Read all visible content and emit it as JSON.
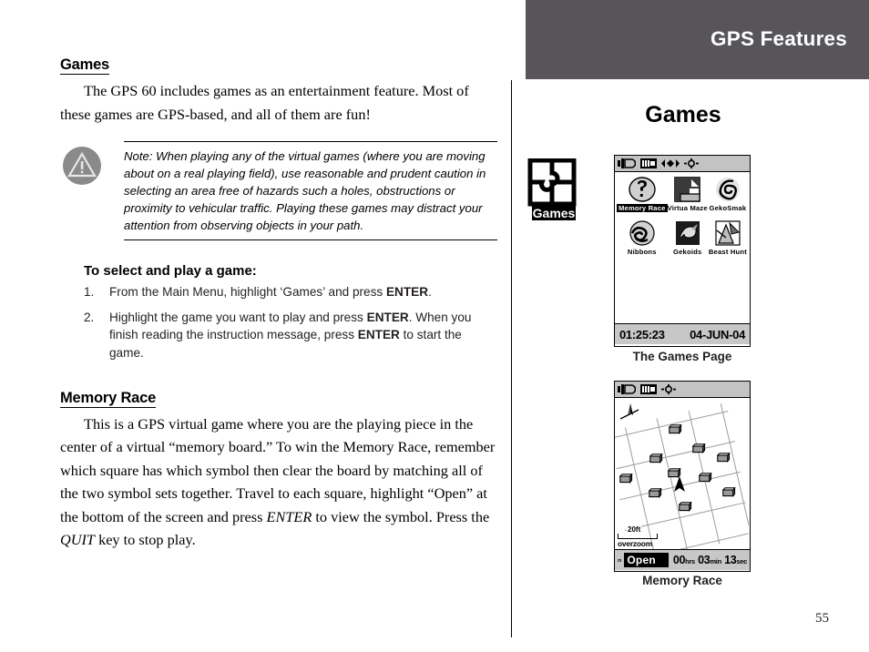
{
  "page": {
    "number": "55",
    "banner_title": "GPS Features",
    "right_heading": "Games"
  },
  "left": {
    "section1": {
      "heading": "Games",
      "paragraph": "The GPS 60 includes games as an entertainment feature. Most of these games are GPS-based, and all of them are fun!"
    },
    "note": {
      "icon": "warning-triangle-icon",
      "text": "Note: When playing any of the virtual games (where you are moving about on a real playing field), use reasonable and prudent caution in selecting an area free of hazards such a holes, obstructions or proximity to vehicular traffic. Playing these games may distract your attention from observing objects in your path."
    },
    "procedure": {
      "heading": "To select and play a game:",
      "steps": [
        {
          "number": "1.",
          "parts": [
            {
              "t": "From the Main Menu, highlight ‘Games’ and press ",
              "b": false
            },
            {
              "t": "ENTER",
              "b": true
            },
            {
              "t": ".",
              "b": false
            }
          ]
        },
        {
          "number": "2.",
          "parts": [
            {
              "t": "Highlight the game you want to play and press ",
              "b": false
            },
            {
              "t": "ENTER",
              "b": true
            },
            {
              "t": ". When you finish reading the instruction message, press ",
              "b": false
            },
            {
              "t": "ENTER",
              "b": true
            },
            {
              "t": " to start the game.",
              "b": false
            }
          ]
        }
      ]
    },
    "section2": {
      "heading": "Memory Race",
      "parts": [
        {
          "t": "This is a GPS virtual game where you are the playing piece in the center of a virtual “memory board.” To win the Memory Race, remember which square has which symbol then clear the board by matching all of the two symbol sets together. Travel to each square, highlight “Open” at the bottom of the screen and press ",
          "i": false
        },
        {
          "t": "ENTER",
          "i": true
        },
        {
          "t": " to view the symbol. Press the ",
          "i": false
        },
        {
          "t": "QUIT",
          "i": true
        },
        {
          "t": " key to stop play.",
          "i": false
        }
      ]
    }
  },
  "right": {
    "games_logo_label": "Games",
    "screens": [
      {
        "id": "games-page",
        "caption": "The Games Page",
        "status_icons": [
          "battery-icon",
          "signal-bars-icon",
          "compass-icon",
          "backlight-icon"
        ],
        "games": [
          {
            "label": "Memory Race",
            "icon": "question-head-icon",
            "selected": true
          },
          {
            "label": "Virtua Maze",
            "icon": "maze-icon",
            "selected": false
          },
          {
            "label": "GekoSmak",
            "icon": "gecko-icon",
            "selected": false
          },
          {
            "label": "Nibbons",
            "icon": "snake-icon",
            "selected": false
          },
          {
            "label": "Gekoids",
            "icon": "gekoids-icon",
            "selected": false
          },
          {
            "label": "Beast Hunt",
            "icon": "beast-icon",
            "selected": false
          }
        ],
        "clock": "01:25:23",
        "date": "04-JUN-04"
      },
      {
        "id": "memory-race",
        "caption": "Memory Race",
        "status_icons": [
          "battery-icon",
          "signal-bars-icon",
          "backlight-icon"
        ],
        "scale": "20ft",
        "overzoom": "overzoom",
        "open_label": "Open",
        "timer": {
          "hrs": "00",
          "hrs_unit": "hrs",
          "min": "03",
          "min_unit": "min",
          "sec": "13",
          "sec_unit": "sec"
        },
        "chest_count": 11
      }
    ]
  }
}
